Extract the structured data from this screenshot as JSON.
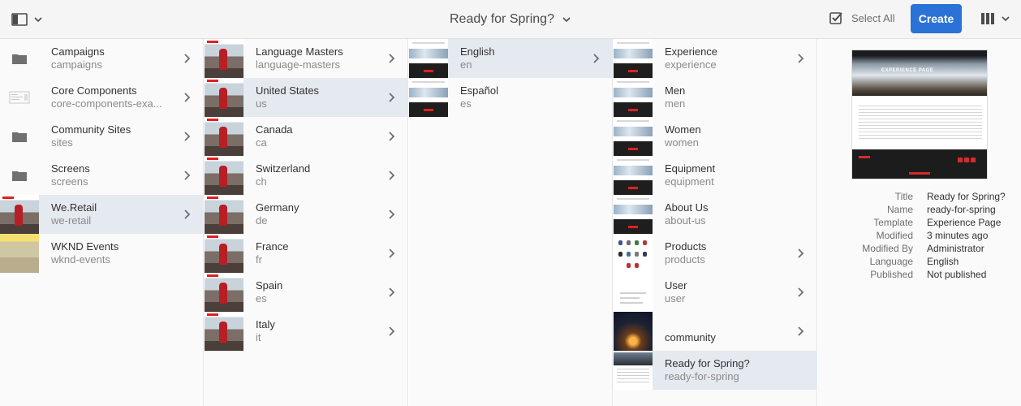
{
  "header": {
    "title": "Ready for Spring?",
    "select_all_label": "Select All",
    "create_label": "Create",
    "accent_color": "#2b72d6"
  },
  "columns": [
    {
      "items": [
        {
          "title": "Campaigns",
          "name": "campaigns",
          "thumb": "folder-icon",
          "has_children": true,
          "selected": false
        },
        {
          "title": "Core Components",
          "name": "core-components-exa...",
          "thumb": "template-icon",
          "has_children": true,
          "selected": false
        },
        {
          "title": "Community Sites",
          "name": "sites",
          "thumb": "folder-icon",
          "has_children": true,
          "selected": false
        },
        {
          "title": "Screens",
          "name": "screens",
          "thumb": "folder-icon",
          "has_children": true,
          "selected": false
        },
        {
          "title": "We.Retail",
          "name": "we-retail",
          "thumb": "we-retail-thumbnail",
          "has_children": true,
          "selected": true
        },
        {
          "title": "WKND Events",
          "name": "wknd-events",
          "thumb": "wknd-thumbnail",
          "has_children": false,
          "selected": false
        }
      ]
    },
    {
      "items": [
        {
          "title": "Language Masters",
          "name": "language-masters",
          "has_children": true,
          "selected": false
        },
        {
          "title": "United States",
          "name": "us",
          "has_children": true,
          "selected": true
        },
        {
          "title": "Canada",
          "name": "ca",
          "has_children": true,
          "selected": false
        },
        {
          "title": "Switzerland",
          "name": "ch",
          "has_children": true,
          "selected": false
        },
        {
          "title": "Germany",
          "name": "de",
          "has_children": true,
          "selected": false
        },
        {
          "title": "France",
          "name": "fr",
          "has_children": true,
          "selected": false
        },
        {
          "title": "Spain",
          "name": "es",
          "has_children": true,
          "selected": false
        },
        {
          "title": "Italy",
          "name": "it",
          "has_children": true,
          "selected": false
        }
      ]
    },
    {
      "items": [
        {
          "title": "English",
          "name": "en",
          "has_children": true,
          "selected": true
        },
        {
          "title": "Español",
          "name": "es",
          "has_children": false,
          "selected": false
        }
      ]
    },
    {
      "items": [
        {
          "title": "Experience",
          "name": "experience",
          "has_children": true,
          "selected": false
        },
        {
          "title": "Men",
          "name": "men",
          "has_children": false,
          "selected": false
        },
        {
          "title": "Women",
          "name": "women",
          "has_children": false,
          "selected": false
        },
        {
          "title": "Equipment",
          "name": "equipment",
          "has_children": false,
          "selected": false
        },
        {
          "title": "About Us",
          "name": "about-us",
          "has_children": false,
          "selected": false
        },
        {
          "title": "Products",
          "name": "products",
          "has_children": true,
          "selected": false
        },
        {
          "title": "User",
          "name": "user",
          "has_children": true,
          "selected": false
        },
        {
          "title": "community",
          "name": "",
          "has_children": true,
          "selected": false
        },
        {
          "title": "Ready for Spring?",
          "name": "ready-for-spring",
          "has_children": false,
          "selected": true
        }
      ]
    }
  ],
  "preview": {
    "hero_title": "EXPERIENCE PAGE",
    "properties": [
      {
        "key": "Title",
        "value": "Ready for Spring?"
      },
      {
        "key": "Name",
        "value": "ready-for-spring"
      },
      {
        "key": "Template",
        "value": "Experience Page"
      },
      {
        "key": "Modified",
        "value": "3 minutes ago"
      },
      {
        "key": "Modified By",
        "value": "Administrator"
      },
      {
        "key": "Language",
        "value": "English"
      },
      {
        "key": "Published",
        "value": "Not published"
      }
    ]
  }
}
